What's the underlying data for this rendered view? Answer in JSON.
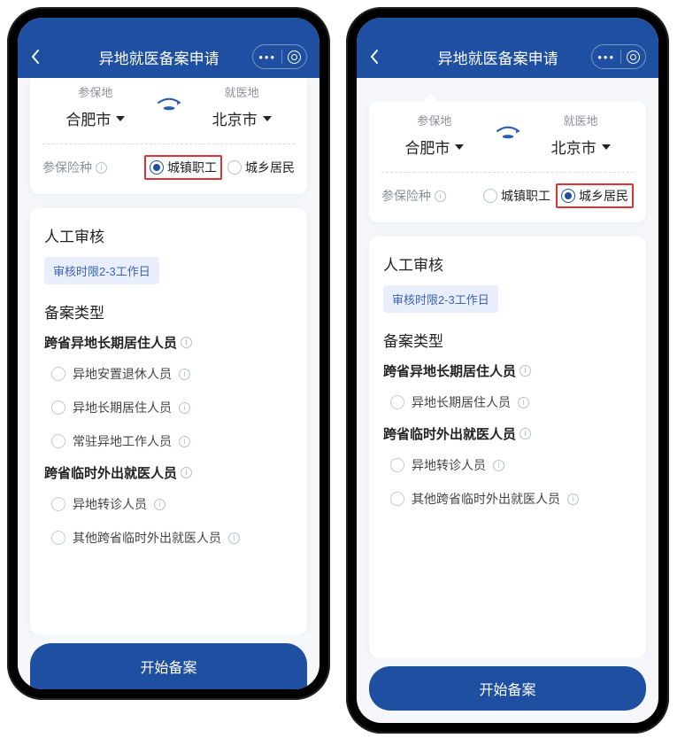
{
  "header": {
    "title": "异地就医备案申请"
  },
  "locations": {
    "insured_label": "参保地",
    "treatment_label": "就医地",
    "insured_city": "合肥市",
    "treatment_city": "北京市"
  },
  "insurance_type": {
    "label": "参保险种",
    "options": {
      "urban_employee": "城镇职工",
      "urban_rural": "城乡居民"
    },
    "selected_left": "urban_employee",
    "selected_right": "urban_rural"
  },
  "review": {
    "title": "人工审核",
    "badge": "审核时限2-3工作日"
  },
  "filing": {
    "title": "备案类型",
    "left": {
      "group1_title": "跨省异地长期居住人员",
      "group1_options": [
        "异地安置退休人员",
        "异地长期居住人员",
        "常驻异地工作人员"
      ],
      "group2_title": "跨省临时外出就医人员",
      "group2_options": [
        "异地转诊人员",
        "其他跨省临时外出就医人员"
      ]
    },
    "right": {
      "group1_title": "跨省异地长期居住人员",
      "group1_options": [
        "异地长期居住人员"
      ],
      "group2_title": "跨省临时外出就医人员",
      "group2_options": [
        "异地转诊人员",
        "其他跨省临时外出就医人员"
      ]
    }
  },
  "submit_label": "开始备案"
}
